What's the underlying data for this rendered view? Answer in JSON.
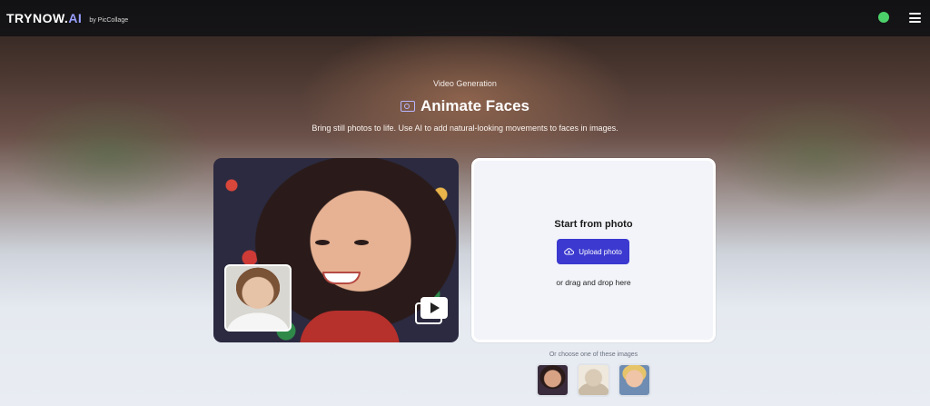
{
  "header": {
    "logo_main": "TRYNOW.",
    "logo_ai": "AI",
    "by_text": "by PicCollage",
    "status_color": "#4cd06a",
    "menu_icon": "hamburger-menu-icon"
  },
  "hero": {
    "eyebrow": "Video Generation",
    "title": "Animate Faces",
    "title_icon": "face-frame-icon",
    "subtitle": "Bring still photos to life. Use AI to add natural-looking movements to faces in images."
  },
  "demo": {
    "main_image": "animated-girl-christmas-portrait",
    "thumb_image": "child-photo-thumbnail",
    "video_icon": "play-video-icon"
  },
  "upload": {
    "title": "Start from photo",
    "button_label": "Upload photo",
    "button_icon": "cloud-upload-icon",
    "drag_text": "or drag and drop here",
    "accent": "#3b39cf"
  },
  "samples": {
    "label": "Or choose one of these images",
    "items": [
      {
        "name": "sample-girl-portrait"
      },
      {
        "name": "sample-vintage-man-portrait"
      },
      {
        "name": "sample-blonde-boy-portrait"
      }
    ]
  }
}
